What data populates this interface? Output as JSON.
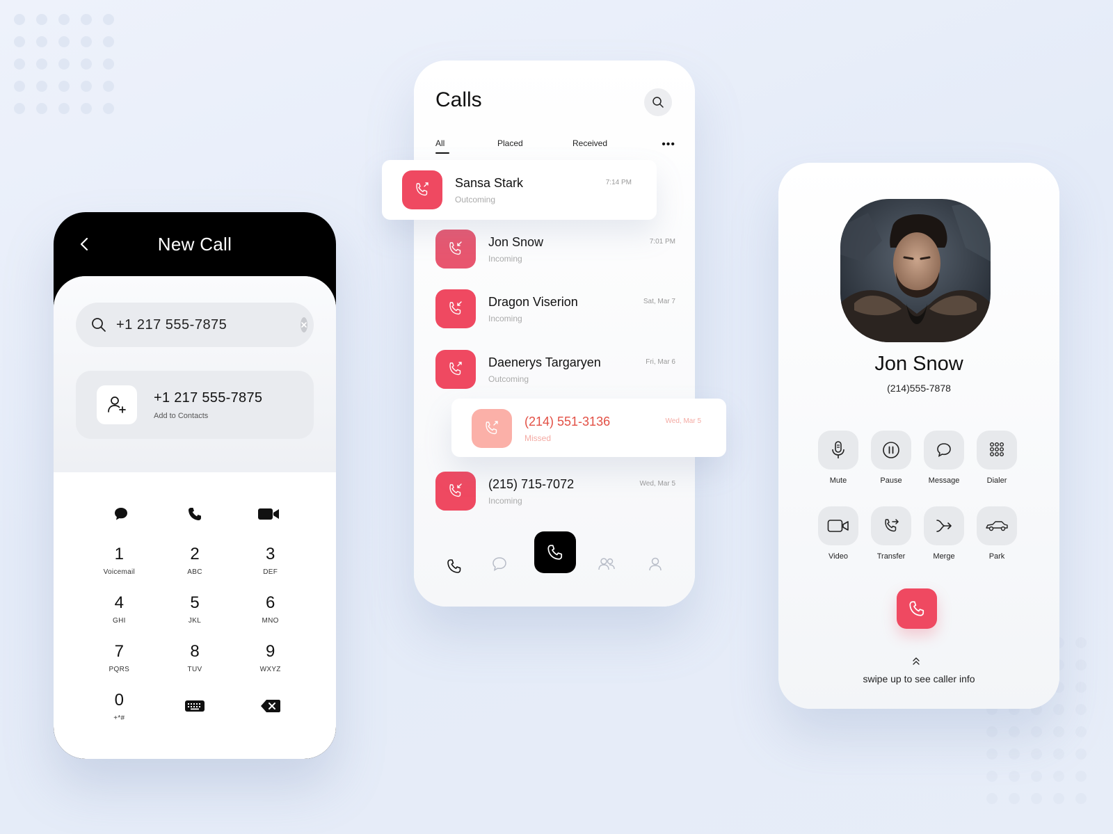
{
  "theme": {
    "accent": "#ef4961",
    "accent_light": "#fbb0a8",
    "missed_red": "#e24f44",
    "panel_grey": "#e9ebef"
  },
  "new_call": {
    "title": "New Call",
    "back_icon": "chevron-left-icon",
    "search_value": "+1 217 555-7875",
    "result": {
      "number": "+1 217 555-7875",
      "subtitle": "Add to Contacts"
    },
    "actions": [
      "message-icon",
      "phone-icon",
      "video-icon"
    ],
    "keys": [
      {
        "digit": "1",
        "letters": "Voicemail"
      },
      {
        "digit": "2",
        "letters": "ABC"
      },
      {
        "digit": "3",
        "letters": "DEF"
      },
      {
        "digit": "4",
        "letters": "GHI"
      },
      {
        "digit": "5",
        "letters": "JKL"
      },
      {
        "digit": "6",
        "letters": "MNO"
      },
      {
        "digit": "7",
        "letters": "PQRS"
      },
      {
        "digit": "8",
        "letters": "TUV"
      },
      {
        "digit": "9",
        "letters": "WXYZ"
      },
      {
        "digit": "0",
        "letters": "+*#"
      },
      {
        "icon": "keyboard-icon"
      },
      {
        "icon": "backspace-icon"
      }
    ]
  },
  "calls": {
    "title": "Calls",
    "tabs": [
      "All",
      "Placed",
      "Received"
    ],
    "active_tab": "All",
    "more_label": "•••",
    "items": [
      {
        "name": "Sansa Stark",
        "status": "Outcoming",
        "time": "7:14 PM",
        "direction": "outgoing"
      },
      {
        "name": "Jon Snow",
        "status": "Incoming",
        "time": "7:01 PM",
        "direction": "incoming"
      },
      {
        "name": "Dragon Viserion",
        "status": "Incoming",
        "time": "Sat,  Mar 7",
        "direction": "incoming"
      },
      {
        "name": "Daenerys Targaryen",
        "status": "Outcoming",
        "time": "Fri, Mar 6",
        "direction": "outgoing"
      },
      {
        "name": "(214) 551-3136",
        "status": "Missed",
        "time": "Wed, Mar 5",
        "direction": "missed"
      },
      {
        "name": "(215) 715-7072",
        "status": "Incoming",
        "time": "Wed, Mar 5",
        "direction": "incoming"
      }
    ],
    "tabbar": [
      "phone-icon",
      "chat-icon",
      "dial-fab-icon",
      "group-icon",
      "profile-icon"
    ]
  },
  "active_call": {
    "name": "Jon Snow",
    "number": "(214)555-7878",
    "controls": [
      "Mute",
      "Pause",
      "Message",
      "Dialer",
      "Video",
      "Transfer",
      "Merge",
      "Park"
    ],
    "end_icon": "hang-up-icon",
    "swipe_hint": "swipe up to see caller info"
  }
}
